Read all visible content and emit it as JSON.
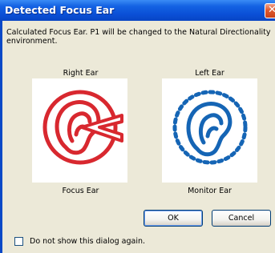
{
  "window": {
    "title": "Detected Focus Ear",
    "close_symbol": "✕"
  },
  "message": "Calculated Focus Ear.  P1 will be changed to the Natural Directionality environment.",
  "right_panel": {
    "heading": "Right Ear",
    "caption": "Focus Ear",
    "icon": "focus-ear-icon",
    "color": "#d8282f"
  },
  "left_panel": {
    "heading": "Left Ear",
    "caption": "Monitor Ear",
    "icon": "monitor-ear-icon",
    "color": "#1565b5"
  },
  "buttons": {
    "ok_label": "OK",
    "cancel_label": "Cancel"
  },
  "checkbox": {
    "label": "Do not show this dialog again.",
    "checked": false
  }
}
